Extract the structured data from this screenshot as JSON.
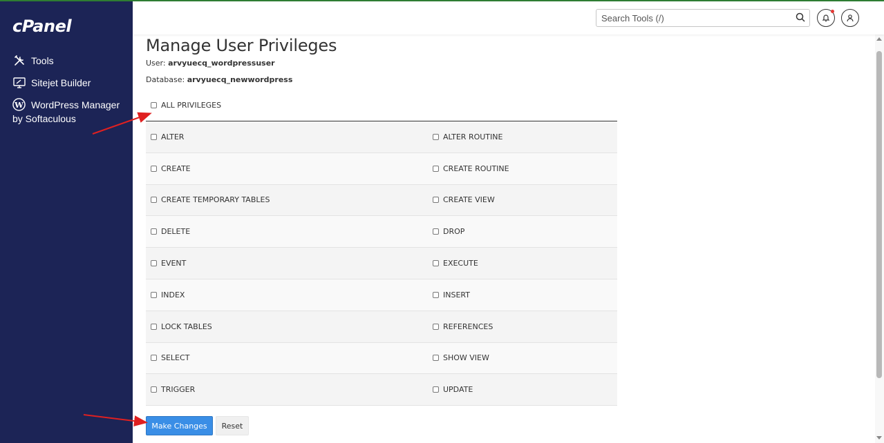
{
  "brand": {
    "logo_text": "cPanel",
    "sidebar_bg": "#1c2456",
    "accent": "#3a8ee6"
  },
  "sidebar": {
    "items": [
      {
        "label": "Tools",
        "icon": "tools-icon"
      },
      {
        "label": "Sitejet Builder",
        "icon": "monitor-edit-icon"
      },
      {
        "label": "WordPress Manager by Softaculous",
        "icon": "wordpress-icon"
      }
    ]
  },
  "header": {
    "search_placeholder": "Search Tools (/)"
  },
  "page": {
    "title": "Manage User Privileges",
    "user_label": "User:",
    "user_value": "arvyuecq_wordpressuser",
    "db_label": "Database:",
    "db_value": "arvyuecq_newwordpress",
    "all_privileges": "ALL PRIVILEGES",
    "privileges": [
      [
        "ALTER",
        "ALTER ROUTINE"
      ],
      [
        "CREATE",
        "CREATE ROUTINE"
      ],
      [
        "CREATE TEMPORARY TABLES",
        "CREATE VIEW"
      ],
      [
        "DELETE",
        "DROP"
      ],
      [
        "EVENT",
        "EXECUTE"
      ],
      [
        "INDEX",
        "INSERT"
      ],
      [
        "LOCK TABLES",
        "REFERENCES"
      ],
      [
        "SELECT",
        "SHOW VIEW"
      ],
      [
        "TRIGGER",
        "UPDATE"
      ]
    ],
    "make_changes": "Make Changes",
    "reset": "Reset"
  },
  "annotation_color": "#e02020"
}
